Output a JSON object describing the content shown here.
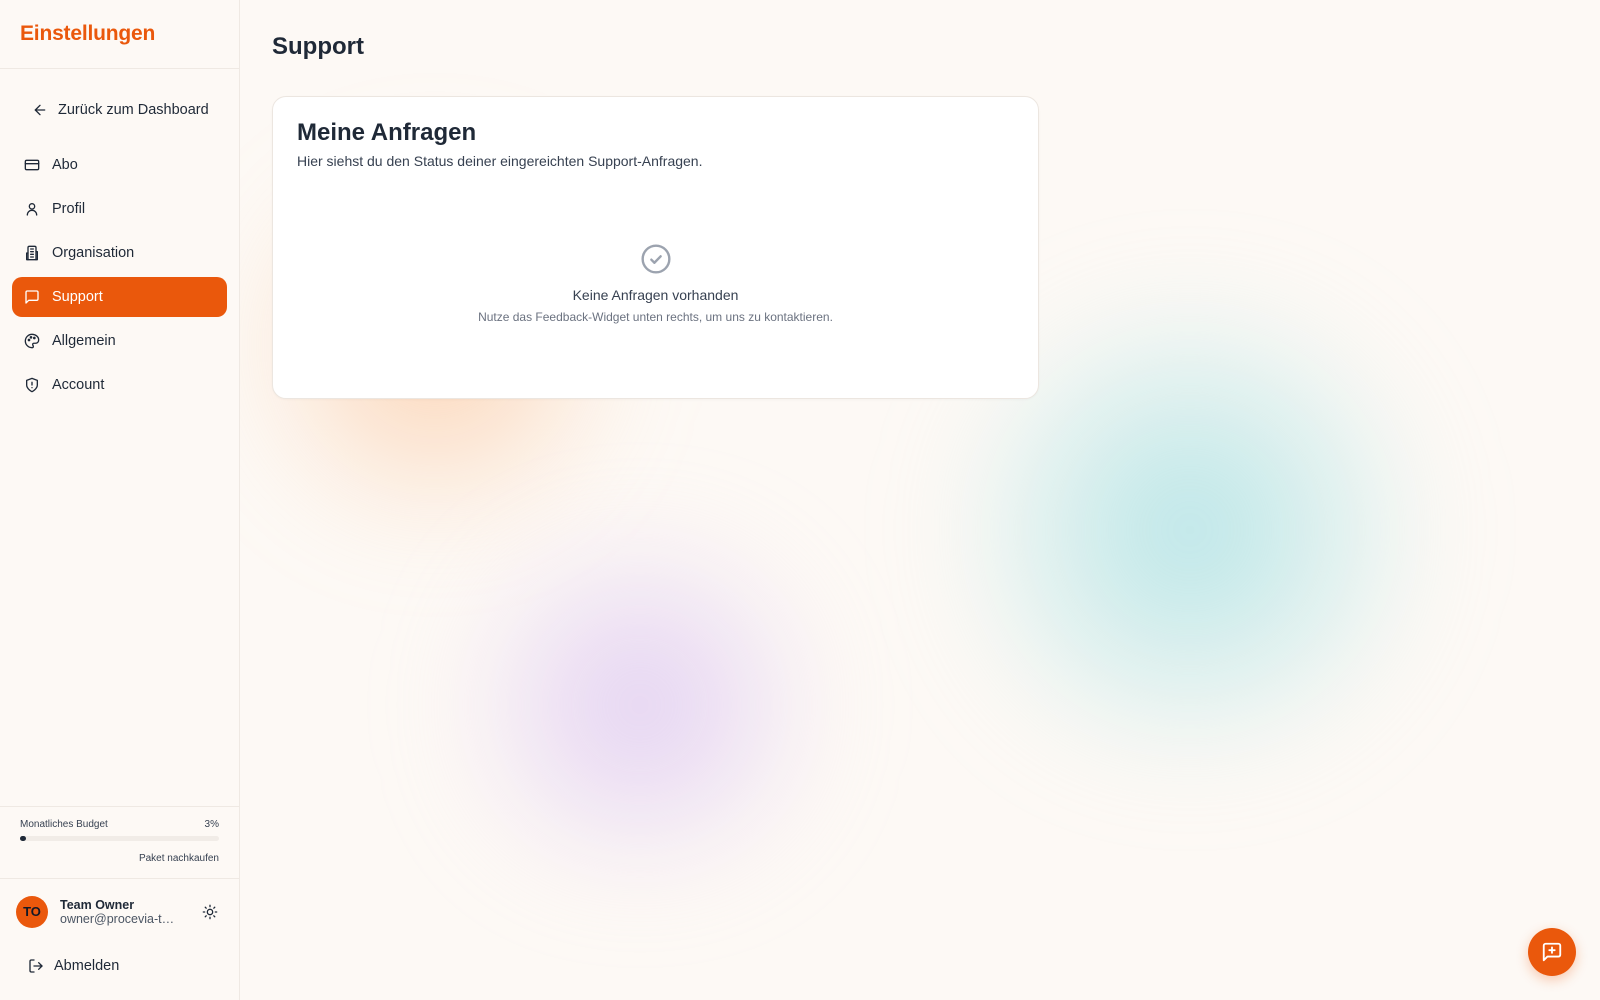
{
  "colors": {
    "accent": "#ea580c",
    "background": "#fdf9f5",
    "text": "#1f2937"
  },
  "sidebar": {
    "title": "Einstellungen",
    "back_label": "Zurück zum Dashboard",
    "items": [
      {
        "label": "Abo",
        "icon": "credit-card-icon",
        "active": false
      },
      {
        "label": "Profil",
        "icon": "user-icon",
        "active": false
      },
      {
        "label": "Organisation",
        "icon": "building-icon",
        "active": false
      },
      {
        "label": "Support",
        "icon": "message-square-icon",
        "active": true
      },
      {
        "label": "Allgemein",
        "icon": "palette-icon",
        "active": false
      },
      {
        "label": "Account",
        "icon": "shield-icon",
        "active": false
      }
    ],
    "budget": {
      "label": "Monatliches Budget",
      "percent_text": "3%",
      "percent": 3,
      "buy_label": "Paket nachkaufen"
    },
    "user": {
      "initials": "TO",
      "name": "Team Owner",
      "email": "owner@procevia-te..."
    },
    "logout_label": "Abmelden"
  },
  "main": {
    "page_title": "Support",
    "card": {
      "title": "Meine Anfragen",
      "subtitle": "Hier siehst du den Status deiner eingereichten Support-Anfragen.",
      "empty_title": "Keine Anfragen vorhanden",
      "empty_text": "Nutze das Feedback-Widget unten rechts, um uns zu kontaktieren."
    }
  }
}
